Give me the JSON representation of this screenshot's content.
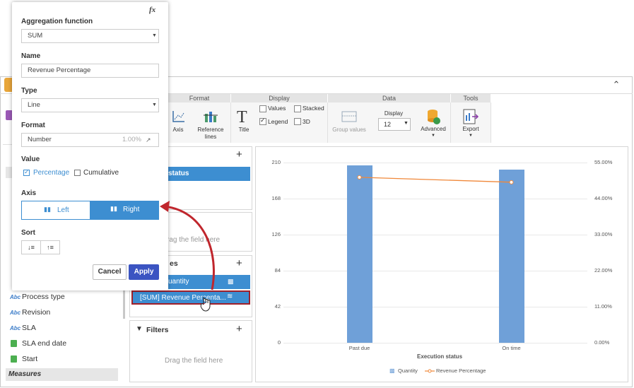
{
  "ribbon": {
    "groups": {
      "format": "Format",
      "display": "Display",
      "data": "Data",
      "tools": "Tools"
    },
    "axis_label": "Axis",
    "reference_lines_label1": "Reference",
    "reference_lines_label2": "lines",
    "title_label": "Title",
    "values_label": "Values",
    "stacked_label": "Stacked",
    "legend_label": "Legend",
    "threed_label": "3D",
    "group_values_label": "Group values",
    "display_label": "Display",
    "display_value": "12",
    "advanced_label": "Advanced",
    "export_label": "Export"
  },
  "fields": {
    "process_type": "Process type",
    "revision": "Revision",
    "sla": "SLA",
    "sla_end_date": "SLA end date",
    "start": "Start",
    "measures": "Measures",
    "abc": "Abc"
  },
  "panels": {
    "status_pill": "status",
    "drag_here": "rag the field here",
    "values_header_tail": "es",
    "quantity_pill": "uantity",
    "revenue_pill": "[SUM] Revenue Percenta...",
    "filters": "Filters",
    "filters_drag": "Drag the field here"
  },
  "chart_data": {
    "type": "bar",
    "categories": [
      "Past due",
      "On time"
    ],
    "series": [
      {
        "name": "Quantity",
        "type": "bar",
        "axis": "left",
        "values": [
          207,
          202
        ]
      },
      {
        "name": "Revenue Percentage",
        "type": "line",
        "axis": "right",
        "values": [
          0.505,
          0.49
        ]
      }
    ],
    "xlabel": "Execution status",
    "ylim": [
      0,
      210
    ],
    "y2lim": [
      0,
      0.55
    ],
    "yticks": [
      "0",
      "42",
      "84",
      "126",
      "168",
      "210"
    ],
    "y2ticks": [
      "0.00%",
      "11.00%",
      "22.00%",
      "33.00%",
      "44.00%",
      "55.00%"
    ],
    "colors": {
      "bar": "#6fa0d8",
      "line": "#f0883a"
    },
    "legend": "bottom",
    "grid": true
  },
  "popup": {
    "fx": "fx",
    "aggregation_label": "Aggregation function",
    "aggregation_value": "SUM",
    "name_label": "Name",
    "name_value": "Revenue Percentage",
    "type_label": "Type",
    "type_value": "Line",
    "format_label": "Format",
    "format_value": "Number",
    "format_sample": "1.00%",
    "value_label": "Value",
    "percentage": "Percentage",
    "cumulative": "Cumulative",
    "axis_label": "Axis",
    "axis_left": "Left",
    "axis_right": "Right",
    "sort_label": "Sort",
    "cancel": "Cancel",
    "apply": "Apply"
  },
  "colors": {
    "accent": "#3d8ed1",
    "apply": "#3b54c2",
    "arrow": "#c0262d"
  }
}
